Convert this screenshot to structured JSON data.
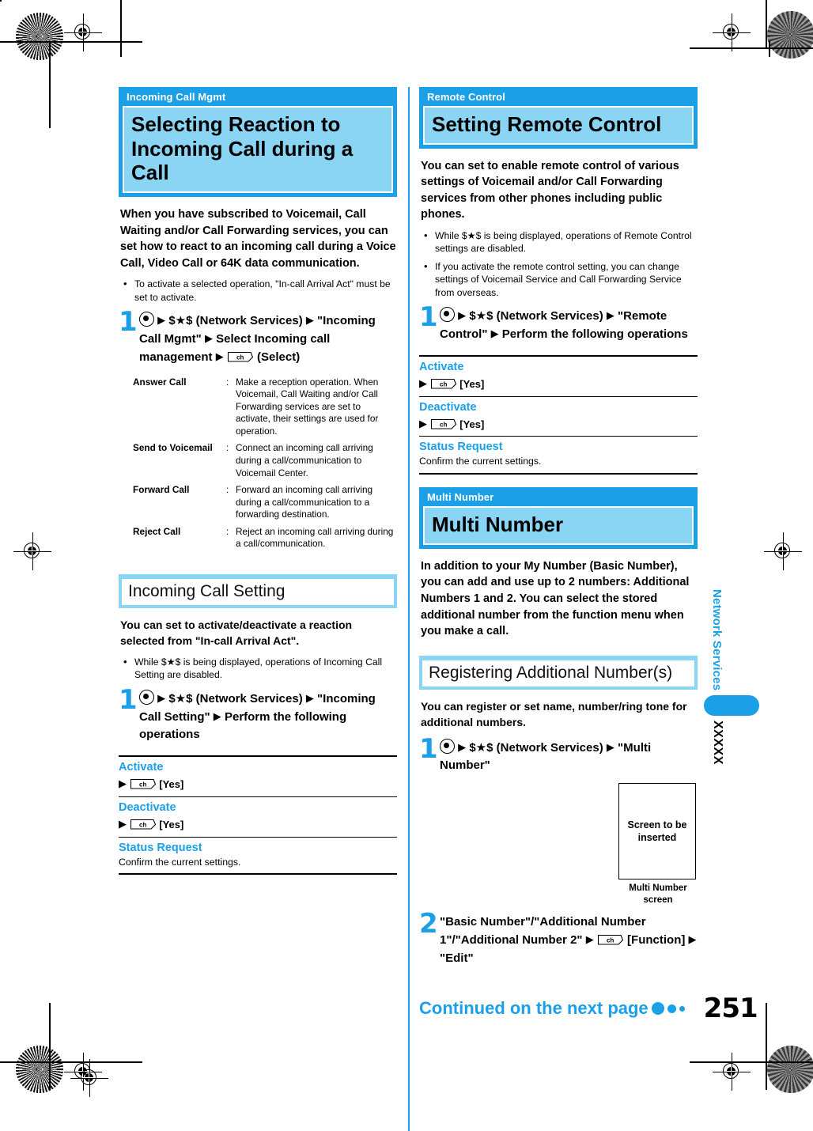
{
  "page": {
    "number": "251",
    "continued_label": "Continued on the next page"
  },
  "side_tab": {
    "chapter": "Network Services",
    "code": "XXXXX"
  },
  "left_column": {
    "chapter": {
      "tag": "Incoming Call Mgmt",
      "title": "Selecting Reaction to Incoming Call during a Call"
    },
    "lead": "When you have subscribed to Voicemail, Call Waiting and/or Call Forwarding services, you can set how to react to an incoming call during a Voice Call, Video Call or 64K data communication.",
    "bullets": [
      "To activate a selected operation, \"In-call Arrival Act\" must be set to activate."
    ],
    "step1": {
      "num": "1",
      "parts": [
        {
          "type": "icon",
          "name": "center-key-icon"
        },
        {
          "type": "arrow"
        },
        {
          "type": "text",
          "value": "$★$ (Network Services)"
        },
        {
          "type": "arrow"
        },
        {
          "type": "text",
          "value": "\"Incoming Call Mgmt\""
        },
        {
          "type": "arrow"
        },
        {
          "type": "text",
          "value": "Select Incoming call management"
        },
        {
          "type": "arrow"
        },
        {
          "type": "icon",
          "name": "ch-key-icon"
        },
        {
          "type": "text",
          "value": "(Select)"
        }
      ],
      "flat": "◉ ▸ $★$ (Network Services) ▸ \"Incoming Call Mgmt\" ▸ Select Incoming call management ▸ [ch] (Select)"
    },
    "definitions": [
      {
        "term": "Answer Call",
        "sep": ":",
        "desc": "Make a reception operation. When Voicemail, Call Waiting and/or Call Forwarding services are set to activate, their settings are used for operation."
      },
      {
        "term": "Send to Voicemail",
        "sep": ":",
        "desc": "Connect an incoming call arriving during a call/communication to Voicemail Center."
      },
      {
        "term": "Forward Call",
        "sep": ":",
        "desc": "Forward an incoming call arriving during a call/communication to a forwarding destination."
      },
      {
        "term": "Reject Call",
        "sep": ":",
        "desc": "Reject an incoming call arriving during a call/communication."
      }
    ],
    "subsection": {
      "title": "Incoming Call Setting",
      "lead": "You can set to activate/deactivate a reaction selected from \"In-call Arrival Act\".",
      "bullets": [
        "While $★$ is being displayed, operations of Incoming Call Setting are disabled."
      ],
      "step1": {
        "num": "1",
        "flat": "◉ ▸ $★$ (Network Services) ▸ \"Incoming Call Setting\" ▸ Perform the following operations"
      },
      "options": [
        {
          "label": "Activate",
          "line": "[Yes]",
          "has_key": true,
          "desc": ""
        },
        {
          "label": "Deactivate",
          "line": "[Yes]",
          "has_key": true,
          "desc": ""
        },
        {
          "label": "Status Request",
          "line": "",
          "has_key": false,
          "desc": "Confirm the current settings."
        }
      ]
    }
  },
  "right_column": {
    "chapter": {
      "tag": "Remote Control",
      "title": "Setting Remote Control"
    },
    "lead": "You can set to enable remote control of various settings of Voicemail and/or Call Forwarding services from other phones including public phones.",
    "bullets": [
      "While $★$ is being displayed, operations of Remote Control settings are disabled.",
      "If you activate the remote control setting, you can change settings of Voicemail Service and Call Forwarding Service from overseas."
    ],
    "step1": {
      "num": "1",
      "flat": "◉ ▸ $★$ (Network Services) ▸ \"Remote Control\" ▸ Perform the following operations"
    },
    "options": [
      {
        "label": "Activate",
        "line": "[Yes]",
        "has_key": true,
        "desc": ""
      },
      {
        "label": "Deactivate",
        "line": "[Yes]",
        "has_key": true,
        "desc": ""
      },
      {
        "label": "Status Request",
        "line": "",
        "has_key": false,
        "desc": "Confirm the current settings."
      }
    ],
    "chapter2": {
      "tag": "Multi Number",
      "title": "Multi Number"
    },
    "lead2": "In addition to your My Number (Basic Number), you can add and use up to 2 numbers: Additional Numbers 1 and 2. You can select the stored additional number from the function menu when you make a call.",
    "subsection2": {
      "title": "Registering Additional Number(s)",
      "lead": "You can register or set name, number/ring tone for additional numbers.",
      "step1": {
        "num": "1",
        "flat": "◉ ▸ $★$ (Network Services) ▸ \"Multi Number\""
      },
      "screen": {
        "placeholder": "Screen to be inserted",
        "caption": "Multi Number screen"
      },
      "step2": {
        "num": "2",
        "flat": "\"Basic Number\"/\"Additional Number 1\"/\"Additional Number 2\" ▸ [ch] [Function] ▸ \"Edit\""
      }
    }
  },
  "colors": {
    "accent": "#1BA0E8",
    "title_bg": "#8BD5F4",
    "text": "#000000"
  }
}
